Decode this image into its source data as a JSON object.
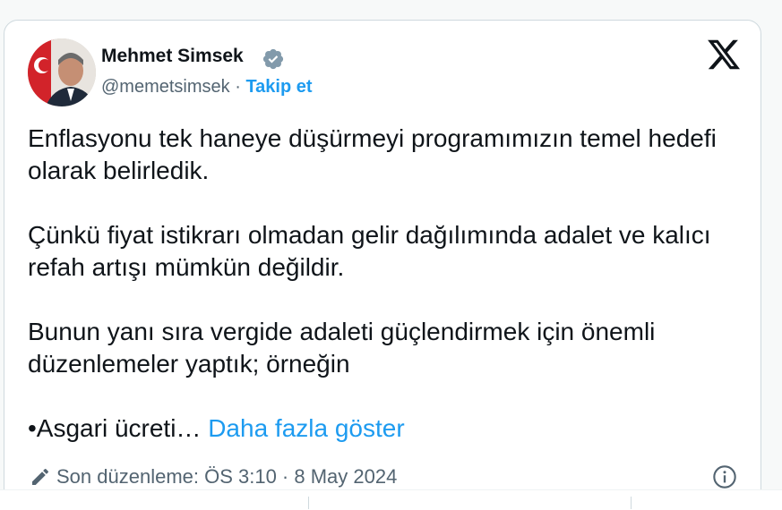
{
  "tweet": {
    "author_name": "Mehmet Simsek",
    "handle": "@memetsimsek",
    "separator": " · ",
    "follow_label": "Takip et",
    "paragraphs": [
      "Enflasyonu tek haneye düşürmeyi programımızın temel hedefi olarak belirledik.",
      "Çünkü fiyat istikrarı olmadan gelir dağılımında adalet ve kalıcı refah artışı mümkün değildir.",
      "Bunun yanı sıra vergide adaleti güçlendirmek için önemli düzenlemeler yaptık; örneğin"
    ],
    "truncated_line": "•Asgari ücreti…",
    "show_more_label": "Daha fazla göster",
    "edited_label": "Son düzenleme: ÖS 3:10 · 8 May 2024"
  },
  "icons": {
    "verified": "verified-badge-icon",
    "platform": "x-logo-icon",
    "edit": "pencil-icon",
    "info": "info-icon"
  },
  "colors": {
    "link": "#1d9bf0",
    "text": "#0f1419",
    "secondary": "#536471",
    "verified_badge": "#829aab"
  }
}
